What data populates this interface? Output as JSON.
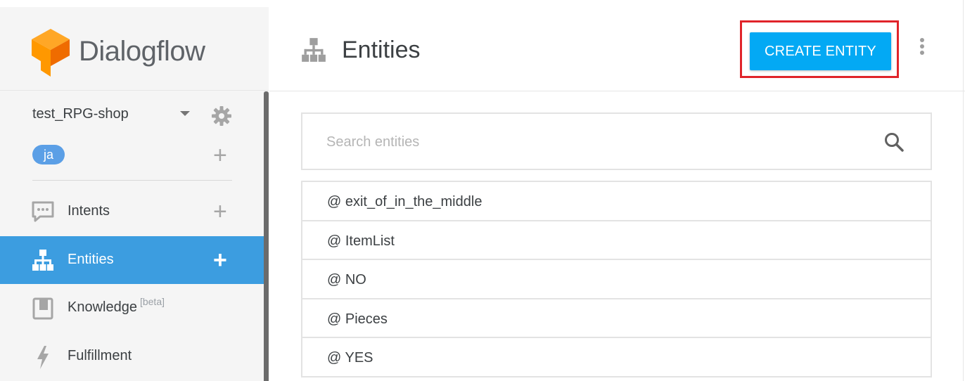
{
  "brand": {
    "name": "Dialogflow",
    "logo_colors": {
      "light": "#ff9800",
      "dark": "#ef6c00"
    }
  },
  "agent": {
    "name": "test_RPG-shop",
    "language": "ja"
  },
  "sidebar": {
    "items": [
      {
        "label": "Intents",
        "icon": "chat-icon"
      },
      {
        "label": "Entities",
        "icon": "hierarchy-icon",
        "active": true
      },
      {
        "label": "Knowledge",
        "badge": "[beta]",
        "icon": "book-icon"
      },
      {
        "label": "Fulfillment",
        "icon": "bolt-icon"
      }
    ]
  },
  "header": {
    "title": "Entities",
    "create_button": "CREATE ENTITY"
  },
  "search": {
    "placeholder": "Search entities",
    "value": ""
  },
  "entities": [
    "@ exit_of_in_the_middle",
    "@ ItemList",
    "@ NO",
    "@ Pieces",
    "@ YES"
  ],
  "colors": {
    "accent": "#3c9de0",
    "button": "#03a9f4",
    "highlight": "#e0242a"
  }
}
